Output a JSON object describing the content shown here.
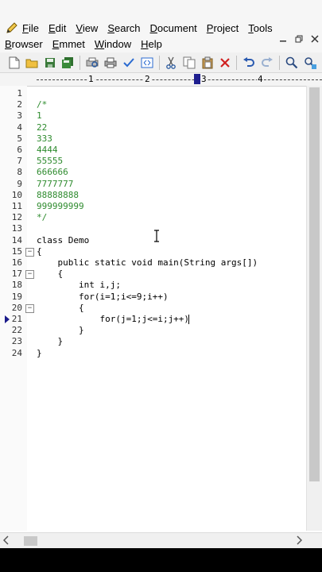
{
  "menu": {
    "row1": [
      "File",
      "Edit",
      "View",
      "Search",
      "Document",
      "Project",
      "Tools"
    ],
    "row2": [
      "Browser",
      "Emmet",
      "Window",
      "Help"
    ]
  },
  "ruler": {
    "labels": [
      "1",
      "2",
      "3",
      "4"
    ]
  },
  "editor": {
    "lines": [
      {
        "n": "1",
        "text": "",
        "cls": ""
      },
      {
        "n": "2",
        "text": "/*",
        "cls": "comment"
      },
      {
        "n": "3",
        "text": "1",
        "cls": "comment"
      },
      {
        "n": "4",
        "text": "22",
        "cls": "comment"
      },
      {
        "n": "5",
        "text": "333",
        "cls": "comment"
      },
      {
        "n": "6",
        "text": "4444",
        "cls": "comment"
      },
      {
        "n": "7",
        "text": "55555",
        "cls": "comment"
      },
      {
        "n": "8",
        "text": "666666",
        "cls": "comment"
      },
      {
        "n": "9",
        "text": "7777777",
        "cls": "comment"
      },
      {
        "n": "10",
        "text": "88888888",
        "cls": "comment"
      },
      {
        "n": "11",
        "text": "999999999",
        "cls": "comment"
      },
      {
        "n": "12",
        "text": "*/",
        "cls": "comment"
      },
      {
        "n": "13",
        "text": "",
        "cls": ""
      },
      {
        "n": "14",
        "text": "class Demo",
        "cls": ""
      },
      {
        "n": "15",
        "text": "{",
        "cls": "",
        "fold": "−"
      },
      {
        "n": "16",
        "text": "    public static void main(String args[])",
        "cls": ""
      },
      {
        "n": "17",
        "text": "    {",
        "cls": "",
        "fold": "−"
      },
      {
        "n": "18",
        "text": "        int i,j;",
        "cls": ""
      },
      {
        "n": "19",
        "text": "        for(i=1;i<=9;i++)",
        "cls": ""
      },
      {
        "n": "20",
        "text": "        {",
        "cls": "",
        "fold": "−"
      },
      {
        "n": "21",
        "text": "            for(j=1;j<=i;j++)",
        "cls": "",
        "caret": true,
        "marker": true
      },
      {
        "n": "22",
        "text": "        }",
        "cls": ""
      },
      {
        "n": "23",
        "text": "    }",
        "cls": ""
      },
      {
        "n": "24",
        "text": "}",
        "cls": ""
      }
    ]
  },
  "colors": {
    "comment": "#2e8b2e",
    "accent": "#1f1f8f"
  },
  "icons": {
    "toolbar": [
      "new-file-icon",
      "open-folder-icon",
      "save-icon",
      "save-all-icon",
      "print-preview-icon",
      "print-icon",
      "spellcheck-icon",
      "view-in-browser-icon",
      "cut-icon",
      "copy-icon",
      "paste-icon",
      "delete-icon",
      "undo-icon",
      "redo-icon",
      "find-icon",
      "replace-icon"
    ]
  }
}
